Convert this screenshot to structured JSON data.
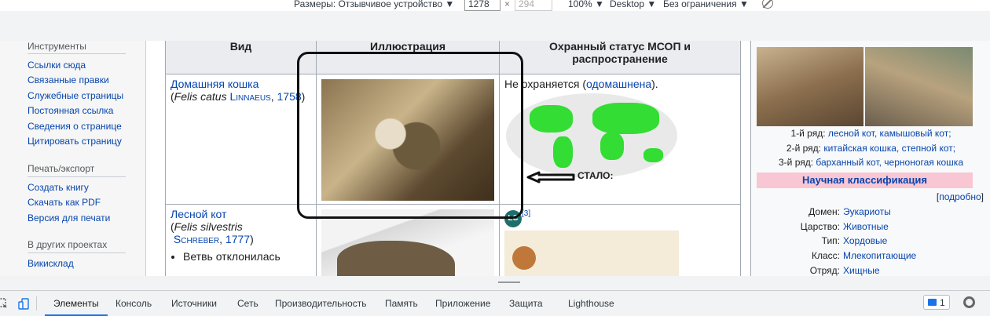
{
  "device_toolbar": {
    "sizes_label": "Размеры: Отзывчивое устройство ▼",
    "width_value": "1278",
    "height_placeholder": "294",
    "zoom": "100% ▼",
    "device": "Desktop ▼",
    "throttle": "Без ограничения ▼"
  },
  "sidebar": {
    "tools_heading": "Инструменты",
    "tools": [
      "Ссылки сюда",
      "Связанные правки",
      "Служебные страницы",
      "Постоянная ссылка",
      "Сведения о странице",
      "Цитировать страницу"
    ],
    "print_heading": "Печать/экспорт",
    "print": [
      "Создать книгу",
      "Скачать как PDF",
      "Версия для печати"
    ],
    "projects_heading": "В других проектах",
    "projects": [
      "Викисклад"
    ]
  },
  "table": {
    "headers": [
      "Вид",
      "Иллюстрация",
      "Охранный статус МСОП и распространение"
    ],
    "rows": [
      {
        "name": "Домашняя кошка",
        "latin": "Felis catus",
        "author": "Linnaeus",
        "year": "1758",
        "status_prefix": "Не охраняется (",
        "status_link": "одомашнена",
        "status_suffix": ")."
      },
      {
        "name": "Лесной кот",
        "latin": "Felis silvestris",
        "author": "Schreber",
        "year": "1777",
        "bullet": "Ветвь отклонилась",
        "status_badge": "LC",
        "status_ref": "[3]"
      }
    ]
  },
  "annotation": {
    "label": "СТАЛО:"
  },
  "infobox": {
    "caption_lines": [
      {
        "prefix": "1-й ряд: ",
        "links": "лесной кот, камышовый кот;"
      },
      {
        "prefix": "2-й ряд: ",
        "links": "китайская кошка, степной кот;"
      },
      {
        "prefix": "3-й ряд: ",
        "links": "барханный кот, черноногая кошка"
      }
    ],
    "sci_heading": "Научная классификация",
    "more_link": "подробно",
    "taxonomy": [
      {
        "k": "Домен:",
        "v": "Эукариоты"
      },
      {
        "k": "Царство:",
        "v": "Животные"
      },
      {
        "k": "Тип:",
        "v": "Хордовые"
      },
      {
        "k": "Класс:",
        "v": "Млекопитающие"
      },
      {
        "k": "Отряд:",
        "v": "Хищные"
      }
    ]
  },
  "devtools": {
    "tabs": [
      "Элементы",
      "Консоль",
      "Источники",
      "Сеть",
      "Производительность",
      "Память",
      "Приложение",
      "Защита",
      "Lighthouse"
    ],
    "issues_count": "1"
  }
}
